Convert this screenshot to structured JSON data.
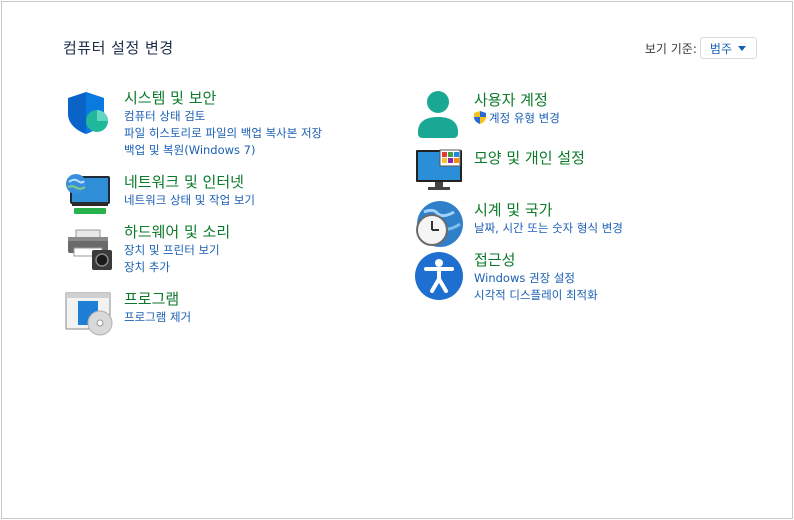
{
  "page": {
    "title": "컴퓨터 설정 변경"
  },
  "viewby": {
    "label": "보기 기준:",
    "value": "범주"
  },
  "left_categories": [
    {
      "title": "시스템 및 보안",
      "links": [
        "컴퓨터 상태 검토",
        "파일 히스토리로 파일의 백업 복사본 저장",
        "백업 및 복원(Windows 7)"
      ]
    },
    {
      "title": "네트워크 및 인터넷",
      "links": [
        "네트워크 상태 및 작업 보기"
      ]
    },
    {
      "title": "하드웨어 및 소리",
      "links": [
        "장치 및 프린터 보기",
        "장치 추가"
      ]
    },
    {
      "title": "프로그램",
      "links": [
        "프로그램 제거"
      ]
    }
  ],
  "right_categories": [
    {
      "title": "사용자 계정",
      "links": [
        "계정 유형 변경"
      ]
    },
    {
      "title": "모양 및 개인 설정",
      "links": []
    },
    {
      "title": "시계 및 국가",
      "links": [
        "날짜, 시간 또는 숫자 형식 변경"
      ]
    },
    {
      "title": "접근성",
      "links": [
        "Windows 권장 설정",
        "시각적 디스플레이 최적화"
      ]
    }
  ],
  "colors": {
    "category_title": "#0c7a2a",
    "link": "#1a5fb4"
  }
}
